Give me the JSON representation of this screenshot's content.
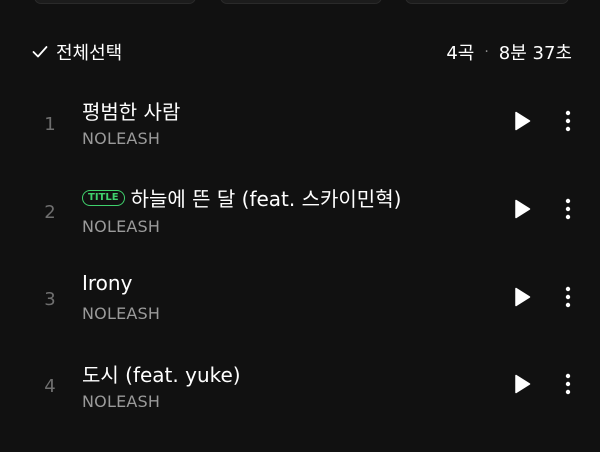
{
  "header": {
    "select_all_label": "전체선택",
    "track_count": "4곡",
    "separator": "·",
    "total_duration": "8분 37초"
  },
  "tracks": [
    {
      "number": "1",
      "title": "평범한 사람",
      "badge": "",
      "artist": "NOLEASH"
    },
    {
      "number": "2",
      "title": "하늘에 뜬 달 (feat. 스카이민혁)",
      "badge": "TITLE",
      "artist": "NOLEASH"
    },
    {
      "number": "3",
      "title": "Irony",
      "badge": "",
      "artist": "NOLEASH"
    },
    {
      "number": "4",
      "title": "도시 (feat. yuke)",
      "badge": "",
      "artist": "NOLEASH"
    }
  ],
  "icons": {
    "checkmark": "check-icon",
    "play": "play-icon",
    "more": "more-vertical-icon"
  },
  "colors": {
    "background": "#111111",
    "title_badge": "#3fd06c",
    "text_primary": "#ffffff",
    "text_secondary": "#9a9a9a"
  }
}
